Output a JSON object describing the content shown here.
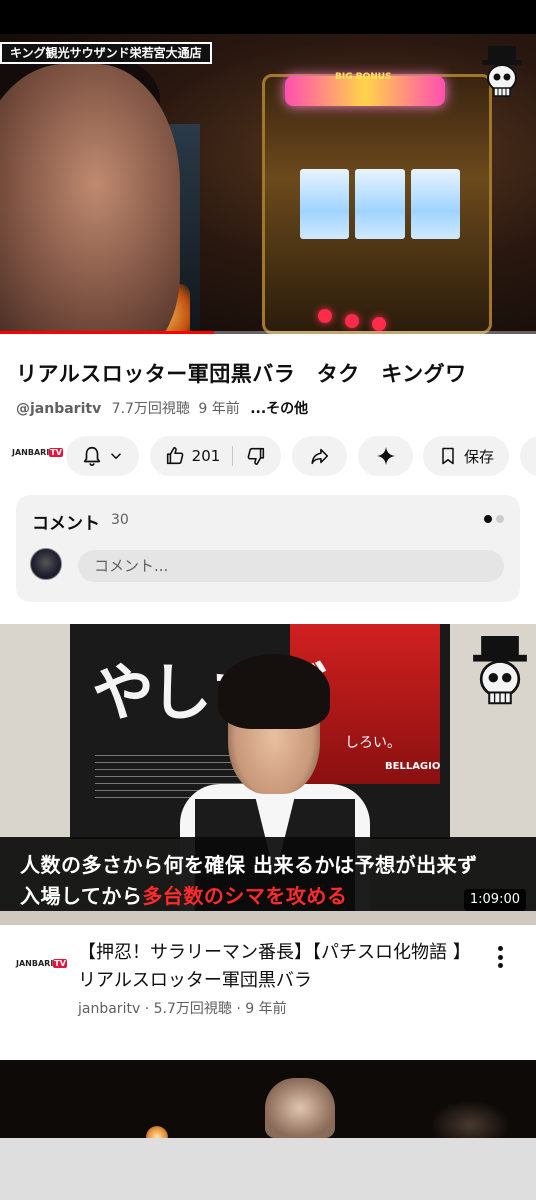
{
  "player": {
    "store_label": "キング観光サウザンド栄若宮大通店",
    "machine_text": "BIG BONUS",
    "progress_fraction": 0.4
  },
  "video": {
    "title": "リアルスロッター軍団黒バラ　タク　キングワ",
    "channel_handle": "@janbaritv",
    "views": "7.7万回視聴",
    "age": "9 年前",
    "more_label": "...その他"
  },
  "actions": {
    "channel_logo_text": "JANBARI",
    "channel_logo_tv": "TV",
    "like_count": "201",
    "save_label": "保存",
    "icons": [
      "bell-icon",
      "chevron-down-icon",
      "thumbs-up-icon",
      "thumbs-down-icon",
      "share-icon",
      "sparkle-icon",
      "bookmark-icon"
    ]
  },
  "comments": {
    "title": "コメント",
    "count": "30",
    "input_placeholder": "コメント..."
  },
  "next_video": {
    "poster_big_text": "やしさぎ",
    "poster_small_text": "しろい。",
    "poster_brand": "BELLAGIO",
    "caption_line1": "人数の多さから何を確保 出来るかは予想が出来ず",
    "caption_line2_prefix": "入場してから",
    "caption_line2_highlight": "多台数のシマを攻める",
    "duration": "1:09:00",
    "channel_logo_text": "JANBARI",
    "channel_logo_tv": "TV",
    "title": "【押忍！サラリーマン番長】【パチスロ化物語 】リアルスロッター軍団黒バラ",
    "channel": "janbaritv",
    "views": "5.7万回視聴",
    "age": "9 年前"
  }
}
